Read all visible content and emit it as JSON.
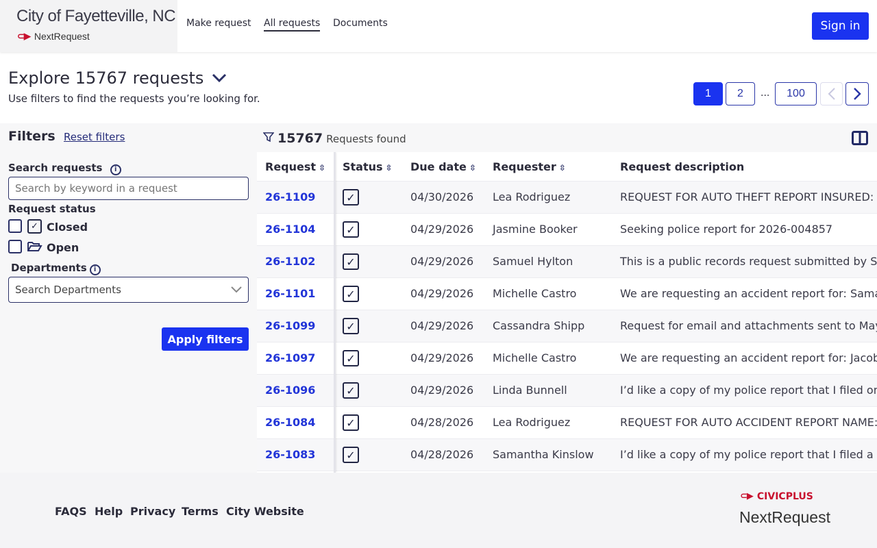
{
  "header": {
    "city": "City of Fayetteville, NC",
    "logo_mark": "cp",
    "product": "NextRequest",
    "nav": [
      "Make request",
      "All requests",
      "Documents"
    ],
    "sign_in": "Sign in"
  },
  "page": {
    "title": "Explore 15767 requests",
    "subtitle": "Use filters to find the requests you’re looking for.",
    "pagination": {
      "pages": [
        "1",
        "2",
        "100"
      ],
      "ellipsis": "...",
      "current": "1"
    }
  },
  "filters": {
    "title": "Filters",
    "reset": "Reset filters",
    "search_label": "Search requests",
    "search_placeholder": "Search by keyword in a request",
    "status_label": "Request status",
    "statuses": [
      "Closed",
      "Open"
    ],
    "departments_label": "Departments",
    "departments_placeholder": "Search Departments",
    "apply": "Apply filters"
  },
  "results": {
    "count": "15767",
    "count_label": "Requests found",
    "columns": [
      "Request",
      "Status",
      "Due date",
      "Requester",
      "Request description"
    ],
    "rows": [
      {
        "id": "26-1109",
        "due": "04/30/2026",
        "requester": "Lea Rodriguez",
        "desc": "REQUEST FOR AUTO THEFT REPORT INSURED: RCR"
      },
      {
        "id": "26-1104",
        "due": "04/29/2026",
        "requester": "Jasmine Booker",
        "desc": "Seeking police report for 2026-004857"
      },
      {
        "id": "26-1102",
        "due": "04/29/2026",
        "requester": "Samuel Hylton",
        "desc": "This is a public records request submitted by Samu"
      },
      {
        "id": "26-1101",
        "due": "04/29/2026",
        "requester": "Michelle Castro",
        "desc": "We are requesting an accident report for: Samanth"
      },
      {
        "id": "26-1099",
        "due": "04/29/2026",
        "requester": "Cassandra Shipp",
        "desc": "Request for email and attachments sent to Mayor C"
      },
      {
        "id": "26-1097",
        "due": "04/29/2026",
        "requester": "Michelle Castro",
        "desc": "We are requesting an accident report for: Jacob Ca"
      },
      {
        "id": "26-1096",
        "due": "04/29/2026",
        "requester": "Linda Bunnell",
        "desc": "I’d like a copy of my police report that I filed on Ma"
      },
      {
        "id": "26-1084",
        "due": "04/28/2026",
        "requester": "Lea Rodriguez",
        "desc": "REQUEST FOR AUTO ACCIDENT REPORT NAME: MA"
      },
      {
        "id": "26-1083",
        "due": "04/28/2026",
        "requester": "Samantha Kinslow",
        "desc": "I’d like a copy of my police report that I filed a few w"
      }
    ]
  },
  "footer": {
    "links": [
      "FAQS",
      "Help",
      "Privacy",
      "Terms",
      "City Website"
    ],
    "brand_top": "CIVICPLUS",
    "brand_bottom": "NextRequest"
  }
}
